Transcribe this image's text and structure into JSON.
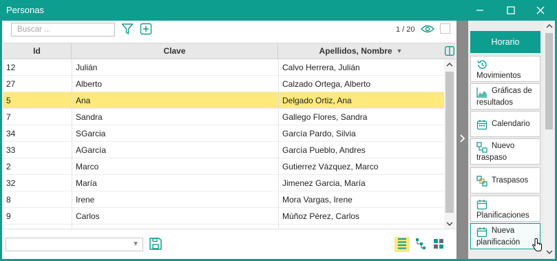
{
  "window": {
    "title": "Personas",
    "accent_color": "#0e9e90",
    "controls": [
      "minimize-icon",
      "maximize-icon",
      "close-icon"
    ]
  },
  "toolbar": {
    "search_placeholder": "Buscar ...",
    "filter_icon": "filter-icon",
    "add_icon": "add-icon",
    "counter": "1 / 20",
    "eye_icon": "eye-icon"
  },
  "grid": {
    "columns": [
      {
        "label": "Id"
      },
      {
        "label": "Clave"
      },
      {
        "label": "Apellidos, Nombre",
        "sort": "descending"
      }
    ],
    "rows": [
      {
        "id": "12",
        "clave": "Julián",
        "apellidos": "Calvo Herrera, Julián",
        "selected": false
      },
      {
        "id": "27",
        "clave": "Alberto",
        "apellidos": "Calzado Ortega, Alberto",
        "selected": false
      },
      {
        "id": "5",
        "clave": "Ana",
        "apellidos": "Delgado Ortiz, Ana",
        "selected": true
      },
      {
        "id": "7",
        "clave": "Sandra",
        "apellidos": "Gallego Flores, Sandra",
        "selected": false
      },
      {
        "id": "34",
        "clave": "SGarcia",
        "apellidos": "García Pardo, Silvia",
        "selected": false
      },
      {
        "id": "33",
        "clave": "AGarcía",
        "apellidos": "García Pueblo, Andres",
        "selected": false
      },
      {
        "id": "2",
        "clave": "Marco",
        "apellidos": "Gutierrez Vázquez, Marco",
        "selected": false
      },
      {
        "id": "32",
        "clave": "María",
        "apellidos": "Jimenez Garcia, María",
        "selected": false
      },
      {
        "id": "8",
        "clave": "Irene",
        "apellidos": "Mora Vargas, Irene",
        "selected": false
      },
      {
        "id": "9",
        "clave": "Carlos",
        "apellidos": "Múñoz Pérez, Carlos",
        "selected": false
      }
    ],
    "selected_row_color": "#fde97c"
  },
  "bottombar": {
    "combo_value": "",
    "save_icon": "save-icon",
    "view_icons": [
      "list-view-icon",
      "tree-view-icon",
      "tiles-view-icon"
    ]
  },
  "rightpanel": {
    "header": "Horario",
    "buttons": [
      {
        "line1": "",
        "line2": "Movimientos",
        "icon": "history-icon"
      },
      {
        "line1": "Gráficas de",
        "line2": "resultados",
        "icon": "chart-icon"
      },
      {
        "line1": "Calendario",
        "line2": "",
        "icon": "calendar-icon"
      },
      {
        "line1": "Nuevo",
        "line2": "traspaso",
        "icon": "transfer-new-icon"
      },
      {
        "line1": "Traspasos",
        "line2": "",
        "icon": "transfers-icon"
      },
      {
        "line1": "",
        "line2": "Planificaciones",
        "icon": "planning-icon"
      },
      {
        "line1": "Nueva",
        "line2": "planificación",
        "icon": "new-planning-icon",
        "hover": true
      }
    ]
  }
}
